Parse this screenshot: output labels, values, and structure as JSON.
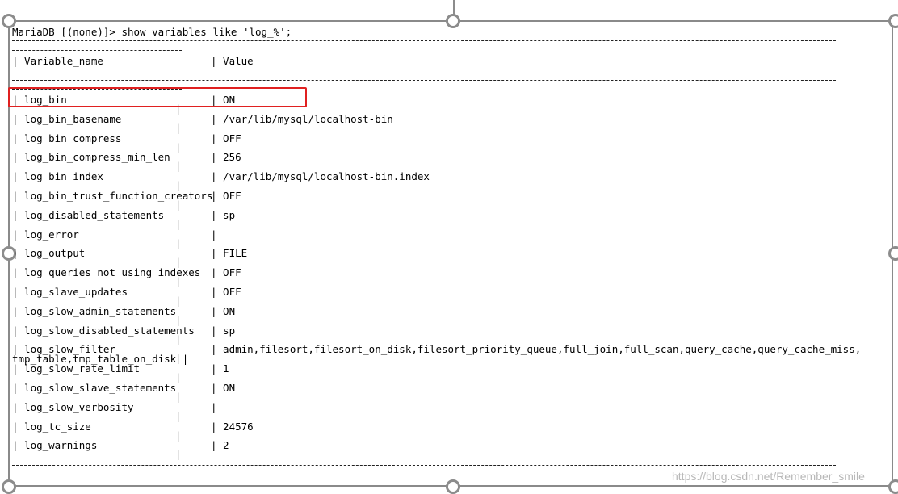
{
  "prompt": "MariaDB [(none)]> show variables like 'log_%';",
  "separator_border": "+-----------------------------+--------------------------------------------------------------------------------------------------------------------------------------------------",
  "columns": {
    "name_header": "| Variable_name",
    "value_header": "| Value"
  },
  "rows": [
    {
      "name": "| log_bin",
      "value": "| ON"
    },
    {
      "name": "| log_bin_basename",
      "value": "| /var/lib/mysql/localhost-bin"
    },
    {
      "name": "| log_bin_compress",
      "value": "| OFF"
    },
    {
      "name": "| log_bin_compress_min_len",
      "value": "| 256"
    },
    {
      "name": "| log_bin_index",
      "value": "| /var/lib/mysql/localhost-bin.index"
    },
    {
      "name": "| log_bin_trust_function_creators",
      "value": "| OFF"
    },
    {
      "name": "| log_disabled_statements",
      "value": "| sp"
    },
    {
      "name": "| log_error",
      "value": "|"
    },
    {
      "name": "| log_output",
      "value": "| FILE"
    },
    {
      "name": "| log_queries_not_using_indexes",
      "value": "| OFF"
    },
    {
      "name": "| log_slave_updates",
      "value": "| OFF"
    },
    {
      "name": "| log_slow_admin_statements",
      "value": "| ON"
    },
    {
      "name": "| log_slow_disabled_statements",
      "value": "| sp"
    },
    {
      "name": "| log_slow_filter",
      "value": "| admin,filesort,filesort_on_disk,filesort_priority_queue,full_join,full_scan,query_cache,query_cache_miss,"
    },
    {
      "name": "| log_slow_rate_limit",
      "value": "| 1"
    },
    {
      "name": "| log_slow_slave_statements",
      "value": "| ON"
    },
    {
      "name": "| log_slow_verbosity",
      "value": "|"
    },
    {
      "name": "| log_tc_size",
      "value": "| 24576"
    },
    {
      "name": "| log_warnings",
      "value": "| 2"
    }
  ],
  "wrap_line": "tmp_table,tmp_table_on_disk |",
  "watermark": "https://blog.csdn.net/Remember_smile",
  "colors": {
    "highlight": "#e02020",
    "frame": "#8a8a8a",
    "watermark": "#b8b8b8"
  }
}
